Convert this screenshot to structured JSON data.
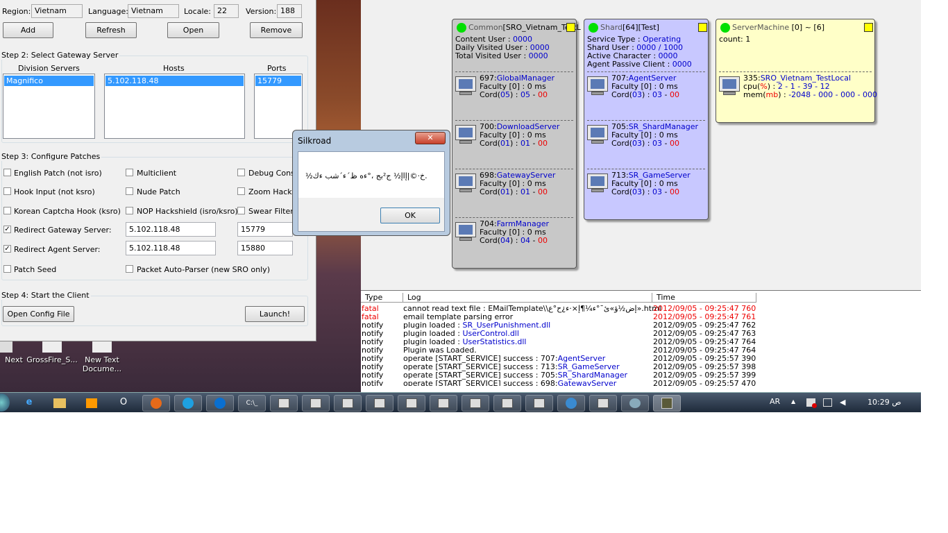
{
  "loader": {
    "region_label": "Region:",
    "region_value": "Vietnam",
    "language_label": "Language:",
    "language_value": "Vietnam",
    "locale_label": "Locale:",
    "locale_value": "22",
    "version_label": "Version:",
    "version_value": "188",
    "add_label": "Add",
    "refresh_label": "Refresh",
    "open_label": "Open",
    "remove_label": "Remove",
    "step2_title": "Step 2: Select Gateway Server",
    "division_header": "Division Servers",
    "hosts_header": "Hosts",
    "ports_header": "Ports",
    "division_item": "Magnifico",
    "host_item": "5.102.118.48",
    "port_item": "15779",
    "step3_title": "Step 3: Configure Patches",
    "patches": {
      "english": "English Patch (not isro)",
      "multiclient": "Multiclient",
      "debug": "Debug Conso",
      "hook_input": "Hook Input (not ksro)",
      "nude": "Nude Patch",
      "zoom": "Zoom Hack",
      "korean": "Korean Captcha Hook (ksro)",
      "nop": "NOP Hackshield (isro/ksro)",
      "swear": "Swear Filter",
      "redirect_gateway": "Redirect Gateway Server:",
      "redirect_agent": "Redirect Agent Server:",
      "patch_seed": "Patch Seed",
      "auto_parser": "Packet Auto-Parser (new SRO only)",
      "check_mark": "✓"
    },
    "gateway_ip": "5.102.118.48",
    "gateway_port": "15779",
    "agent_ip": "5.102.118.48",
    "agent_port": "15880",
    "step4_title": "Step 4: Start the Client",
    "open_config_label": "Open Config File",
    "launch_label": "Launch!"
  },
  "desktop_icons": {
    "next": "Next",
    "grossfire": "GrossFire_S...",
    "new_text_1": "New Text",
    "new_text_2": "Docume..."
  },
  "dialog": {
    "title": "Silkroad",
    "close": "✕",
    "message": "½خ·©|إاإ½ ج²بج ،°ءه ظ´ء´شب ءك.",
    "ok_label": "OK"
  },
  "common": {
    "title_prefix": "Common",
    "title_name": "[SRO_Vietnam_TestL",
    "content_user_label": "Content User : ",
    "content_user": "0000",
    "daily_label": "Daily Visited User : ",
    "daily": "0000",
    "total_label": "Total Visited User : ",
    "total": "0000",
    "services": [
      {
        "id": "697:",
        "name": "GlobalManager",
        "faculty": "Faculty [0] : 0 ms",
        "cord_a": "05",
        "cord_b": "05",
        "cord_c": "00"
      },
      {
        "id": "700:",
        "name": "DownloadServer",
        "faculty": "Faculty [0] : 0 ms",
        "cord_a": "01",
        "cord_b": "01",
        "cord_c": "00"
      },
      {
        "id": "698:",
        "name": "GatewayServer",
        "faculty": "Faculty [0] : 0 ms",
        "cord_a": "01",
        "cord_b": "01",
        "cord_c": "00"
      },
      {
        "id": "704:",
        "name": "FarmManager",
        "faculty": "Faculty [0] : 0 ms",
        "cord_a": "04",
        "cord_b": "04",
        "cord_c": "00"
      }
    ]
  },
  "shard": {
    "title_prefix": "Shard",
    "title_num": "[64]",
    "title_name": "[Test]",
    "service_type_label": "Service Type : ",
    "service_type": "Operating",
    "shard_user_label": "Shard User : ",
    "shard_user": "0000 / 1000",
    "active_label": "Active Character : ",
    "active": "0000",
    "passive_label": "Agent Passive Client : ",
    "passive": "0000",
    "services": [
      {
        "id": "707:",
        "name": "AgentServer",
        "faculty": "Faculty [0] : 0 ms",
        "cord_a": "03",
        "cord_b": "03",
        "cord_c": "00"
      },
      {
        "id": "705:",
        "name": "SR_ShardManager",
        "faculty": "Faculty [0] : 0 ms",
        "cord_a": "03",
        "cord_b": "03",
        "cord_c": "00"
      },
      {
        "id": "713:",
        "name": "SR_GameServer",
        "faculty": "Faculty [0] : 0 ms",
        "cord_a": "03",
        "cord_b": "03",
        "cord_c": "00"
      }
    ]
  },
  "machine": {
    "title_prefix": "ServerMachine",
    "title_range": " [0] ~ [6]",
    "count": "count: 1",
    "id": "335:",
    "name": "SRO_Vietnam_TestLocal",
    "cpu_label": "cpu(",
    "cpu_pct": "%",
    "cpu_close": ") : ",
    "cpu_val": "2 - 1 - 39 - 12",
    "mem_label": "mem(",
    "mem_mb": "mb",
    "mem_close": ") : ",
    "mem_val": "-2048 - 000 - 000 - 000"
  },
  "cord_prefix": "Cord(",
  "cord_mid": ") : ",
  "cord_dash": " - ",
  "log": {
    "col_type": "Type",
    "col_log": "Log",
    "col_time": "Time",
    "rows": [
      {
        "type": "fatal",
        "msg": "cannot read text file : EMailTemplate\\\\إض½ؤ»ئ¯°ء¼¶إ×·ء¿ح°ع».html",
        "time": "2012/09/05 - 09:25:47 760",
        "red": true
      },
      {
        "type": "fatal",
        "msg": "email template parsing error",
        "time": "2012/09/05 - 09:25:47 761",
        "red": true
      },
      {
        "type": "notify",
        "msg": "plugin loaded : ",
        "msg_b": "SR_UserPunishment.dll",
        "time": "2012/09/05 - 09:25:47 762"
      },
      {
        "type": "notify",
        "msg": "plugin loaded : ",
        "msg_b": "UserControl.dll",
        "time": "2012/09/05 - 09:25:47 763"
      },
      {
        "type": "notify",
        "msg": "plugin loaded : ",
        "msg_b": "UserStatistics.dll",
        "time": "2012/09/05 - 09:25:47 764"
      },
      {
        "type": "notify",
        "msg": "Plugin was Loaded.",
        "time": "2012/09/05 - 09:25:47 764"
      },
      {
        "type": "notify",
        "msg": "operate [START_SERVICE] success : 707:",
        "msg_b": "AgentServer",
        "time": "2012/09/05 - 09:25:57 390"
      },
      {
        "type": "notify",
        "msg": "operate [START_SERVICE] success : 713:",
        "msg_b": "SR_GameServer",
        "time": "2012/09/05 - 09:25:57 398"
      },
      {
        "type": "notify",
        "msg": "operate [START_SERVICE] success : 705:",
        "msg_b": "SR_ShardManager",
        "time": "2012/09/05 - 09:25:57 399"
      },
      {
        "type": "notify",
        "msg": "operate [START_SERVICE] success : 698:",
        "msg_b": "GatewayServer",
        "time": "2012/09/05 - 09:25:57 470"
      }
    ]
  },
  "taskbar": {
    "lang": "AR",
    "clock": "10:29 ص",
    "tray_up": "▲",
    "cmd": "C:\\_"
  }
}
